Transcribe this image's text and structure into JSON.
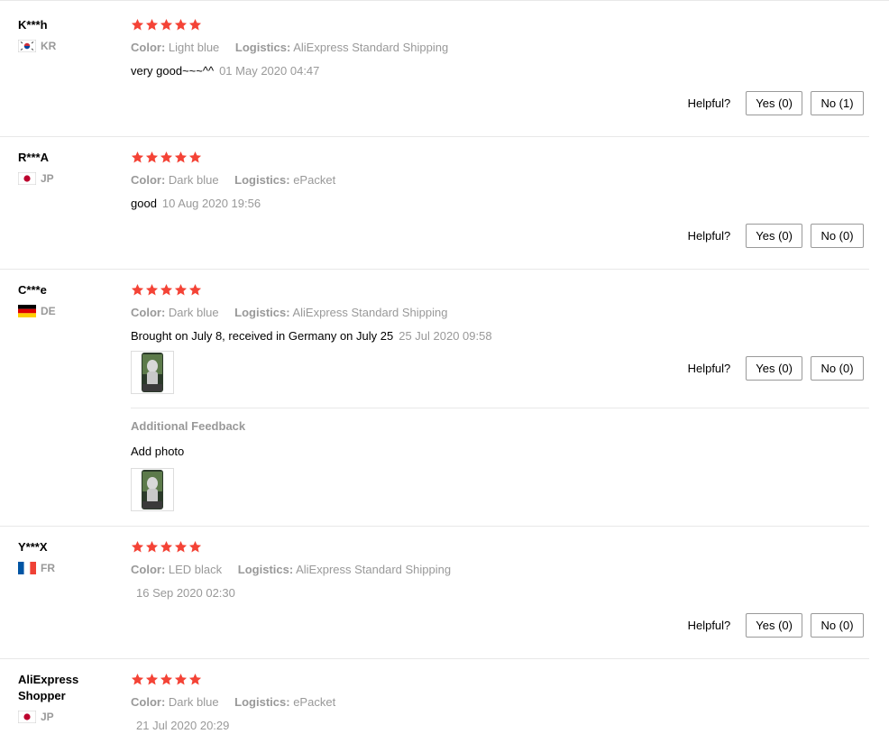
{
  "helpful_label": "Helpful?",
  "meta_labels": {
    "color": "Color:",
    "logistics": "Logistics:"
  },
  "additional_feedback_label": "Additional Feedback",
  "star_color": "#f44336",
  "reviews": [
    {
      "user": "K***h",
      "country": "KR",
      "rating": 5,
      "color": "Light blue",
      "logistics": "AliExpress Standard Shipping",
      "text": "very good~~~^^",
      "date": "01 May 2020 04:47",
      "yes": "Yes (0)",
      "no": "No (1)"
    },
    {
      "user": "R***A",
      "country": "JP",
      "rating": 5,
      "color": "Dark blue",
      "logistics": "ePacket",
      "text": "good",
      "date": "10 Aug 2020 19:56",
      "yes": "Yes (0)",
      "no": "No (0)"
    },
    {
      "user": "C***e",
      "country": "DE",
      "rating": 5,
      "color": "Dark blue",
      "logistics": "AliExpress Standard Shipping",
      "text": "Brought on July 8, received in Germany on July 25",
      "date": "25 Jul 2020 09:58",
      "yes": "Yes (0)",
      "no": "No (0)",
      "additional_text": "Add photo"
    },
    {
      "user": "Y***X",
      "country": "FR",
      "rating": 5,
      "color": "LED black",
      "logistics": "AliExpress Standard Shipping",
      "text": "",
      "date": "16 Sep 2020 02:30",
      "yes": "Yes (0)",
      "no": "No (0)"
    },
    {
      "user_line1": "AliExpress",
      "user_line2": "Shopper",
      "country": "JP",
      "rating": 5,
      "color": "Dark blue",
      "logistics": "ePacket",
      "text": "",
      "date": "21 Jul 2020 20:29"
    }
  ]
}
